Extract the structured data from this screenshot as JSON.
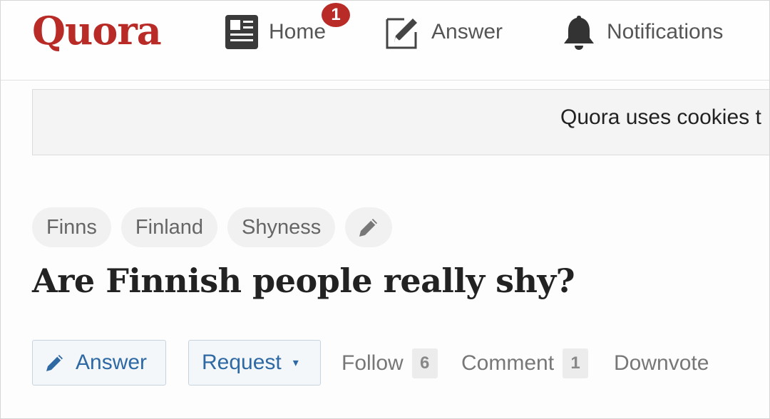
{
  "header": {
    "logo": "Quora",
    "nav": {
      "home": "Home",
      "home_badge": "1",
      "answer": "Answer",
      "notifications": "Notifications"
    }
  },
  "cookie_banner": {
    "text": "Quora uses cookies t"
  },
  "topics": [
    "Finns",
    "Finland",
    "Shyness"
  ],
  "question": {
    "title": "Are Finnish people really shy?"
  },
  "actions": {
    "answer": "Answer",
    "request": "Request",
    "request_caret": "▾",
    "follow": "Follow",
    "follow_count": "6",
    "comment": "Comment",
    "comment_count": "1",
    "downvote": "Downvote"
  },
  "colors": {
    "brand": "#b92b27",
    "link": "#2e69a3"
  },
  "icons": [
    "news-feed-icon",
    "pencil-square-icon",
    "bell-icon",
    "pencil-icon"
  ]
}
